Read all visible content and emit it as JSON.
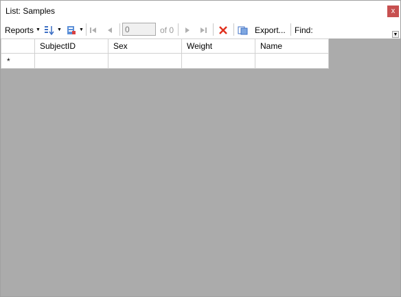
{
  "window": {
    "title": "List: Samples",
    "close_label": "x"
  },
  "toolbar": {
    "reports_label": "Reports",
    "position_value": "0",
    "of_label": "of 0",
    "export_label": "Export...",
    "find_label": "Find:"
  },
  "grid": {
    "columns": [
      "SubjectID",
      "Sex",
      "Weight",
      "Name"
    ],
    "new_row_marker": "*"
  },
  "colors": {
    "close_button": "#c75050",
    "delete_icon": "#e0301e",
    "workspace": "#ababab"
  }
}
